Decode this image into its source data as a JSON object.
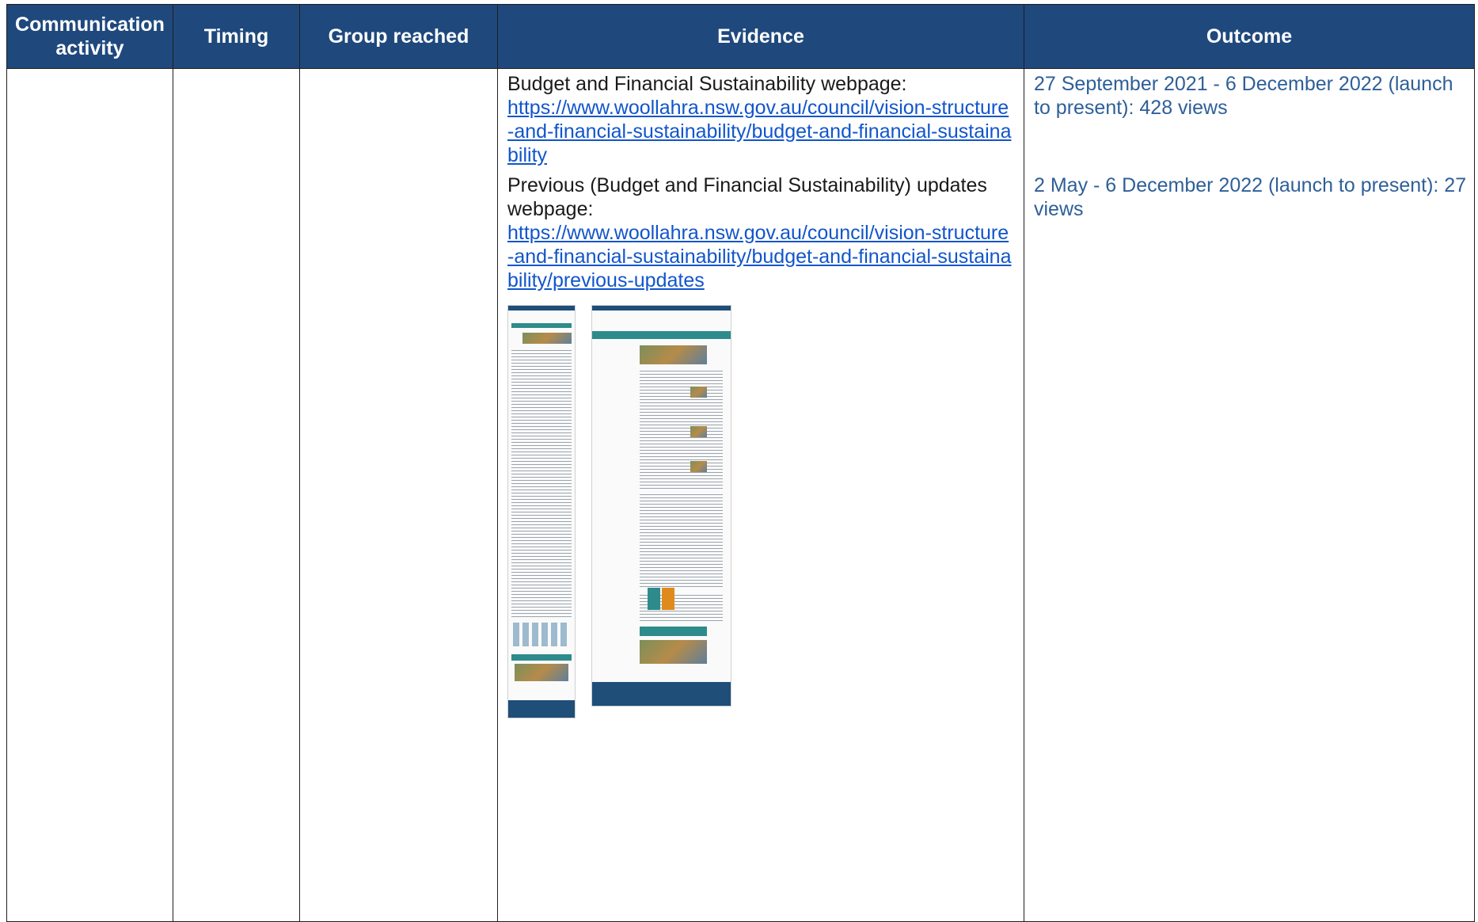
{
  "table": {
    "headers": {
      "communication_activity": "Communication activity",
      "timing": "Timing",
      "group_reached": "Group reached",
      "evidence": "Evidence",
      "outcome": "Outcome"
    },
    "row": {
      "communication_activity": "",
      "timing": "",
      "group_reached": "",
      "evidence": [
        {
          "label": "Budget and Financial Sustainability webpage:",
          "link": "https://www.woollahra.nsw.gov.au/council/vision-structure-and-financial-sustainability/budget-and-financial-sustainability"
        },
        {
          "label": "Previous (Budget and Financial Sustainability) updates webpage:",
          "link": "https://www.woollahra.nsw.gov.au/council/vision-structure-and-financial-sustainability/budget-and-financial-sustainability/previous-updates"
        }
      ],
      "outcome": [
        "27 September 2021 - 6 December 2022 (launch to present): 428 views",
        "2 May - 6 December 2022 (launch to present): 27 views"
      ]
    }
  },
  "colors": {
    "header_bg": "#1f497d",
    "header_text": "#ffffff",
    "link": "#1155cc",
    "outcome_text": "#2e5f98"
  }
}
